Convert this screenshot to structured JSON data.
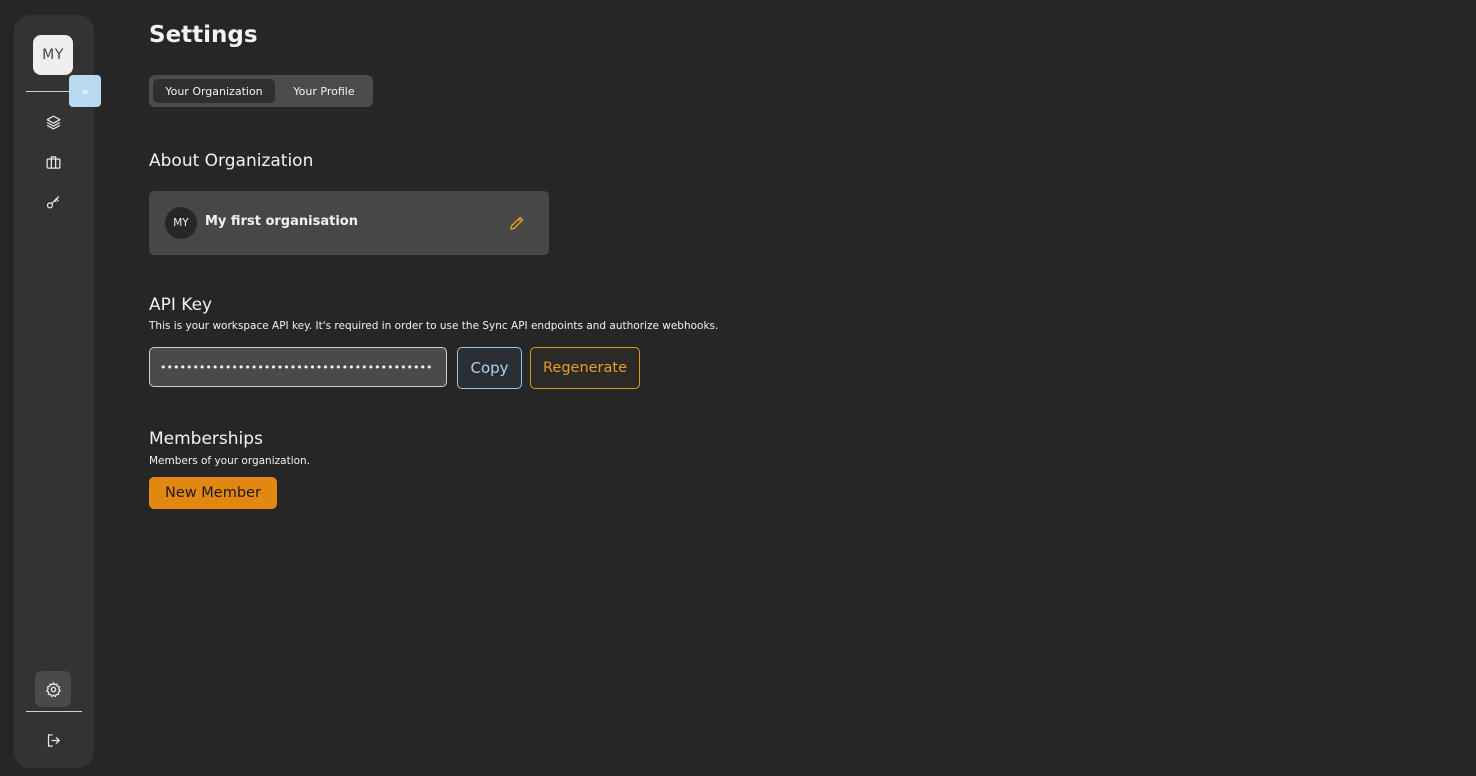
{
  "sidebar": {
    "avatar_initials": "MY",
    "expand_label": "»",
    "nav": [
      {
        "icon": "layers-icon"
      },
      {
        "icon": "briefcase-icon"
      },
      {
        "icon": "key-icon"
      }
    ],
    "bottom": [
      {
        "icon": "gear-icon",
        "active": true
      },
      {
        "icon": "logout-icon"
      }
    ]
  },
  "header": {
    "title": "Settings"
  },
  "tabs": [
    {
      "label": "Your Organization",
      "active": true
    },
    {
      "label": "Your Profile",
      "active": false
    }
  ],
  "about": {
    "title": "About Organization",
    "org_initials": "MY",
    "org_name": "My first organisation"
  },
  "api_key": {
    "title": "API Key",
    "description": "This is your workspace API key. It's required in order to use the Sync API endpoints and authorize webhooks.",
    "masked_value": "••••••••••••••••••••••••••••••••••••••••••",
    "copy_label": "Copy",
    "regenerate_label": "Regenerate"
  },
  "memberships": {
    "title": "Memberships",
    "description": "Members of your organization.",
    "new_member_label": "New Member"
  },
  "colors": {
    "background": "#262626",
    "sidebar": "#333333",
    "accent_orange": "#e2870f",
    "accent_blue": "#8fc4ea"
  }
}
